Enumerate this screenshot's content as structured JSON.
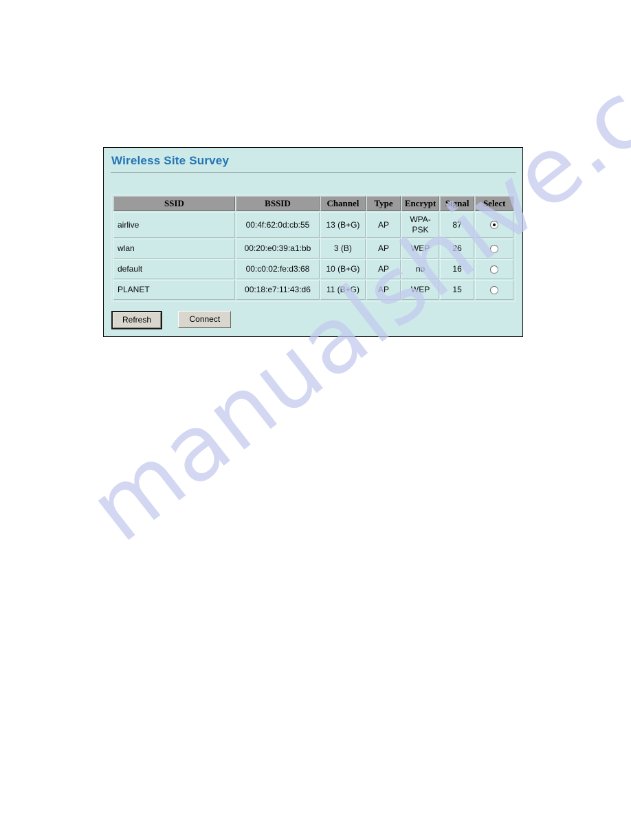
{
  "panel": {
    "title": "Wireless Site Survey"
  },
  "table": {
    "columns": [
      {
        "key": "ssid",
        "label": "SSID"
      },
      {
        "key": "bssid",
        "label": "BSSID"
      },
      {
        "key": "channel",
        "label": "Channel"
      },
      {
        "key": "type",
        "label": "Type"
      },
      {
        "key": "encrypt",
        "label": "Encrypt"
      },
      {
        "key": "signal",
        "label": "Signal"
      },
      {
        "key": "select",
        "label": "Select"
      }
    ],
    "rows": [
      {
        "ssid": "airlive",
        "bssid": "00:4f:62:0d:cb:55",
        "channel": "13 (B+G)",
        "type": "AP",
        "encrypt": "WPA-PSK",
        "signal": "87",
        "selected": true
      },
      {
        "ssid": "wlan",
        "bssid": "00:20:e0:39:a1:bb",
        "channel": "3 (B)",
        "type": "AP",
        "encrypt": "WEP",
        "signal": "26",
        "selected": false
      },
      {
        "ssid": "default",
        "bssid": "00:c0:02:fe:d3:68",
        "channel": "10 (B+G)",
        "type": "AP",
        "encrypt": "no",
        "signal": "16",
        "selected": false
      },
      {
        "ssid": "PLANET",
        "bssid": "00:18:e7:11:43:d6",
        "channel": "11 (B+G)",
        "type": "AP",
        "encrypt": "WEP",
        "signal": "15",
        "selected": false
      }
    ]
  },
  "buttons": {
    "refresh_label": "Refresh",
    "connect_label": "Connect"
  },
  "watermark": {
    "text": "manualshive.com"
  },
  "colors": {
    "panel_background": "#cdeae8",
    "panel_border": "#0b0b0b",
    "title_text": "#2374b5",
    "header_background": "#9b9b9b",
    "button_face": "#d9d6cd",
    "watermark": "#c3c9ee"
  }
}
